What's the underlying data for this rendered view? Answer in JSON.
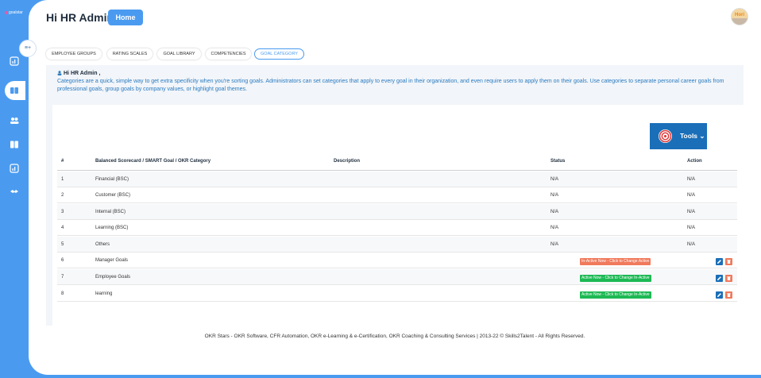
{
  "sidebar": {
    "brand": "goalstar",
    "icons": [
      "chart-icon",
      "book-icon",
      "users-icon",
      "library-icon",
      "report-icon",
      "handshake-icon"
    ]
  },
  "header": {
    "greeting": "Hi HR Admin",
    "home_label": "Home",
    "avatar_text": "Hori"
  },
  "tabs": [
    {
      "label": "EMPLOYEE GROUPS",
      "active": false
    },
    {
      "label": "RATING SCALES",
      "active": false
    },
    {
      "label": "GOAL LIBRARY",
      "active": false
    },
    {
      "label": "COMPETENCIES",
      "active": false
    },
    {
      "label": "GOAL CATEGORY",
      "active": true
    }
  ],
  "info": {
    "title": "Hi HR Admin ,",
    "text": "Categories are a quick, simple way to get extra specificity when you're sorting goals. Administrators can set categories that apply to every goal in their organization, and even require users to apply them on their goals. Use categories to separate personal career goals from professional goals, group goals by company values, or highlight goal themes."
  },
  "tools": {
    "label": "Tools ⌄"
  },
  "table": {
    "headers": {
      "num": "#",
      "category": "Balanced Scorecard / SMART Goal / OKR Category",
      "description": "Description",
      "status": "Status",
      "action": "Action"
    },
    "rows": [
      {
        "num": "1",
        "category": "Financial (BSC)",
        "description": "",
        "status": "N/A",
        "action": "N/A"
      },
      {
        "num": "2",
        "category": "Customer (BSC)",
        "description": "",
        "status": "N/A",
        "action": "N/A"
      },
      {
        "num": "3",
        "category": "Internal (BSC)",
        "description": "",
        "status": "N/A",
        "action": "N/A"
      },
      {
        "num": "4",
        "category": "Learning (BSC)",
        "description": "",
        "status": "N/A",
        "action": "N/A"
      },
      {
        "num": "5",
        "category": "Others",
        "description": "",
        "status": "N/A",
        "action": "N/A"
      },
      {
        "num": "6",
        "category": "Manager Goals",
        "description": "",
        "status_pill": "In-Active Now - Click to Change Active",
        "pill_kind": "inactive"
      },
      {
        "num": "7",
        "category": "Employee Goals",
        "description": "",
        "status_pill": "Active Now - Click to Change In-Active",
        "pill_kind": "active"
      },
      {
        "num": "8",
        "category": "learning",
        "description": "",
        "status_pill": "Active Now - Click to Change In-Active",
        "pill_kind": "active"
      }
    ]
  },
  "footer": "OKR Stars - OKR Software, CFR Automation, OKR e-Learning & e-Certification, OKR Coaching & Consulting Services | 2013-22 © Skills2Talent - All Rights Reserved.",
  "colors": {
    "brand_blue": "#4a9bf0",
    "tools_blue": "#1a6fb8",
    "inactive": "#f07a5c",
    "active": "#1db954"
  }
}
